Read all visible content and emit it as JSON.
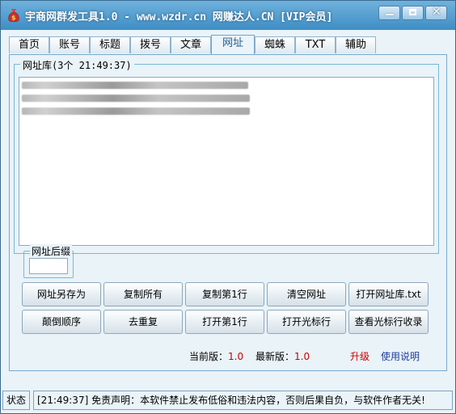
{
  "window": {
    "title": "宇商网群发工具1.0 - www.wzdr.cn 网赚达人.CN [VIP会员]",
    "accent": "#3f8ec5",
    "minimize_label": "_",
    "maximize_label": "□",
    "close_label": "✕"
  },
  "tabs": [
    {
      "label": "首页",
      "active": false
    },
    {
      "label": "账号",
      "active": false
    },
    {
      "label": "标题",
      "active": false
    },
    {
      "label": "拨号",
      "active": false
    },
    {
      "label": "文章",
      "active": false
    },
    {
      "label": "网址",
      "active": true
    },
    {
      "label": "蜘蛛",
      "active": false
    },
    {
      "label": "TXT",
      "active": false
    },
    {
      "label": "辅助",
      "active": false
    }
  ],
  "url_library": {
    "legend": "网址库(3个 21:49:37)",
    "lines_blurred": 3
  },
  "suffix": {
    "legend": "网址后缀",
    "value": ""
  },
  "buttons": {
    "save_as": "网址另存为",
    "copy_all": "复制所有",
    "copy_first": "复制第1行",
    "clear": "清空网址",
    "open_library": "打开网址库.txt",
    "reverse": "颠倒顺序",
    "dedupe": "去重复",
    "open_first": "打开第1行",
    "open_cursor": "打开光标行",
    "view_cursor": "查看光标行收录"
  },
  "version": {
    "current_label": "当前版：",
    "current_value": "1.0",
    "latest_label": "最新版：",
    "latest_value": "1.0",
    "upgrade": "升级",
    "help": "使用说明"
  },
  "status": {
    "label": "状态",
    "message": "[21:49:37] 免责声明：本软件禁止发布低俗和违法内容，否则后果自负，与软件作者无关!"
  }
}
